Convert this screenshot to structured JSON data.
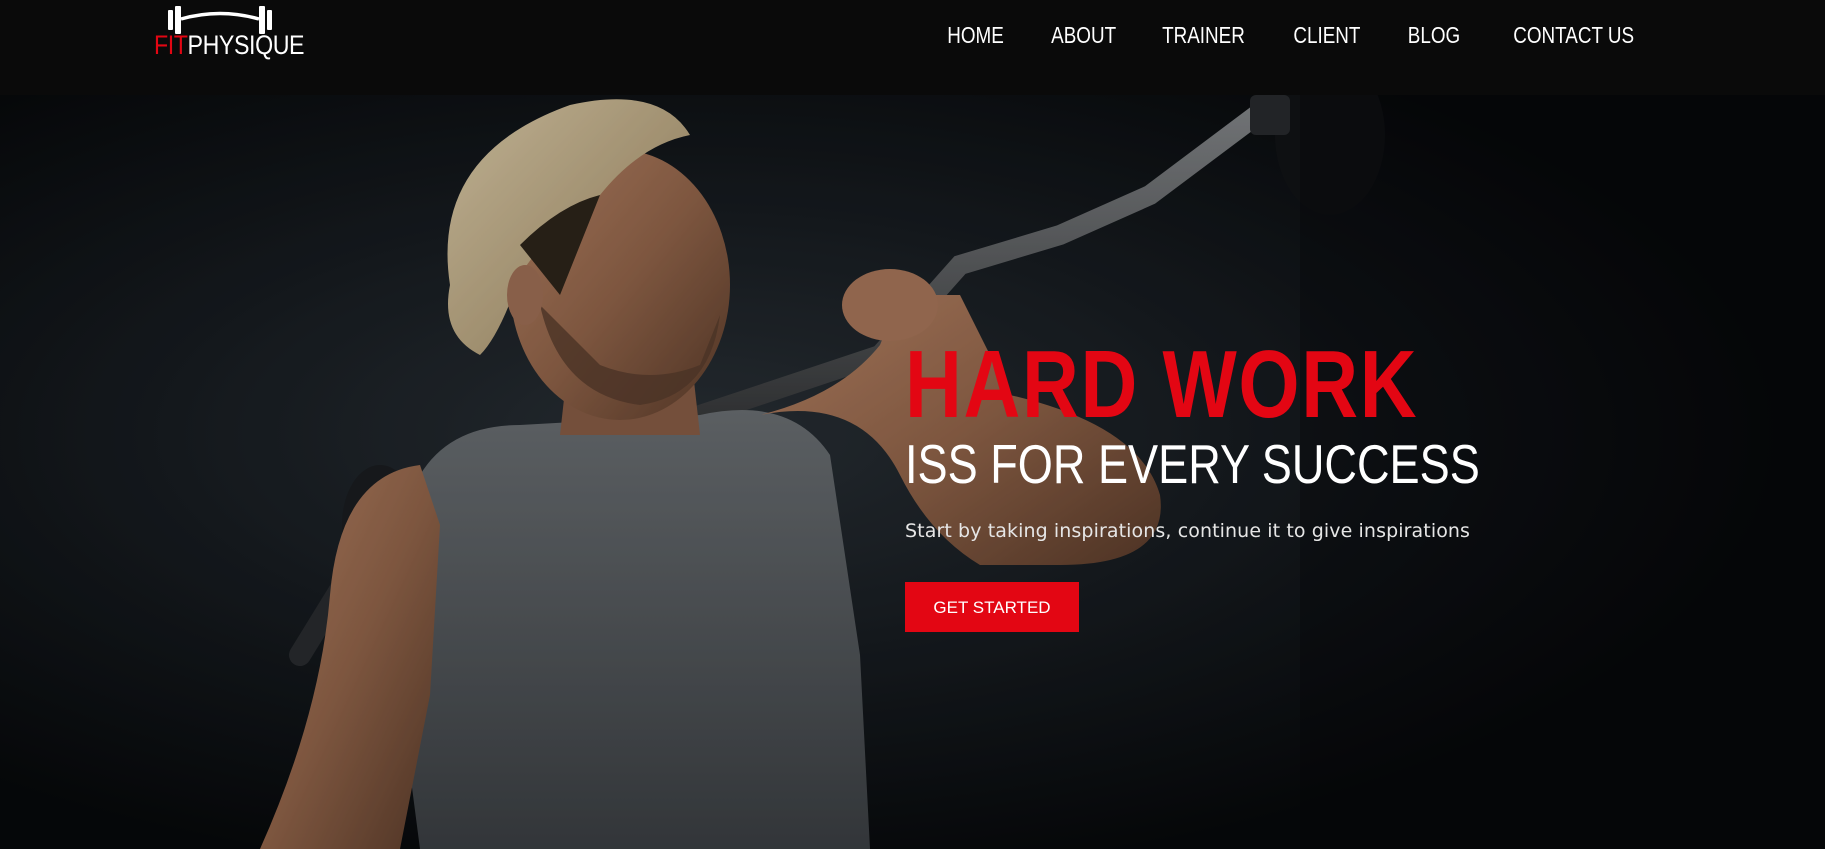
{
  "brand": {
    "logo_part1": "FIT",
    "logo_part2": "PHYSIQUE",
    "accent_color": "#e30613"
  },
  "nav": {
    "items": [
      {
        "label": "HOME"
      },
      {
        "label": "ABOUT"
      },
      {
        "label": "TRAINER"
      },
      {
        "label": "CLIENT"
      },
      {
        "label": "BLOG"
      },
      {
        "label": "CONTACT US"
      }
    ]
  },
  "hero": {
    "title": "HARD WORK",
    "subtitle": "ISS FOR EVERY SUCCESS",
    "tagline": "Start by taking inspirations, continue it to give inspirations",
    "cta_label": "GET STARTED",
    "background_image": "man-lifting-barbell-photo"
  }
}
